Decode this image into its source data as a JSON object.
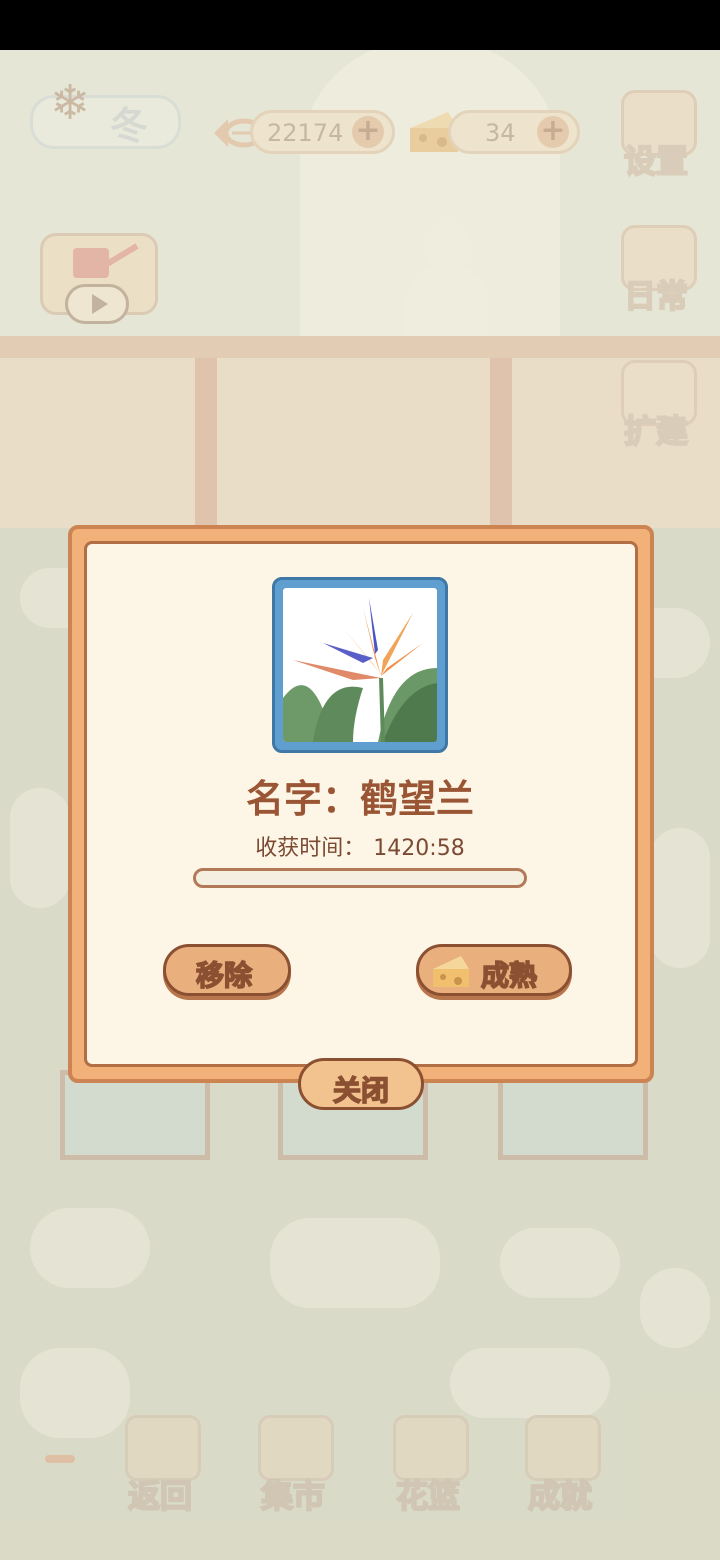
{
  "hud": {
    "season_label": "冬",
    "fish_value": "22174",
    "cheese_value": "34",
    "plus_glyph": "+",
    "settings_label": "设置",
    "daily_label": "日常",
    "expand_label": "扩建"
  },
  "dialog": {
    "plant_name": "名字：鹤望兰",
    "harvest_label": "收获时间：",
    "harvest_time": "1420:58",
    "progress_fraction": 0,
    "remove_label": "移除",
    "ripen_label": "成熟",
    "close_label": "关闭"
  },
  "bottom_nav": {
    "back_label": "返回",
    "market_label": "集市",
    "basket_label": "花篮",
    "achievement_label": "成就"
  },
  "colors": {
    "dialog_border": "#f2b179",
    "dialog_inner": "#fdf6e6",
    "button": "#e9b07d",
    "text_brown": "#9a5634",
    "frame_blue": "#5e9fd0"
  },
  "icons": [
    "fish-bone-icon",
    "cheese-icon",
    "gear-icon",
    "daily-list-icon",
    "hammer-icon",
    "watering-can-icon",
    "play-icon",
    "snowy-tree-icon"
  ]
}
